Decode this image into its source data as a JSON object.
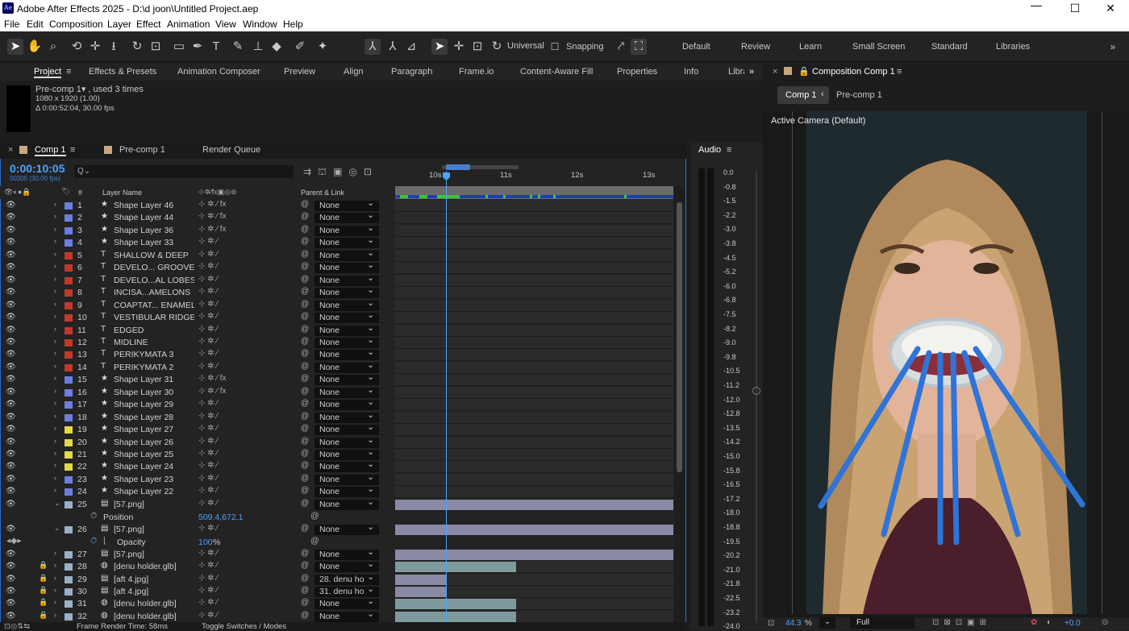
{
  "window": {
    "title": "Adobe After Effects 2025 - D:\\d joon\\Untitled Project.aep",
    "app_badge": "Ae"
  },
  "menu": [
    "File",
    "Edit",
    "Composition",
    "Layer",
    "Effect",
    "Animation",
    "View",
    "Window",
    "Help"
  ],
  "toolbar": {
    "universal_label": "Universal",
    "snapping_label": "Snapping"
  },
  "workspaces": [
    "Default",
    "Review",
    "Learn",
    "Small Screen",
    "Standard",
    "Libraries"
  ],
  "panel_tabs": [
    "Project",
    "Effects & Presets",
    "Animation Composer",
    "Preview",
    "Align",
    "Paragraph",
    "Frame.io",
    "Content-Aware Fill",
    "Properties",
    "Info",
    "Libra"
  ],
  "project_info": {
    "name": "Pre-comp 1▾ , used 3 times",
    "dims": "1080 x 1920 (1.00)",
    "duration": "Δ 0:00:52:04, 30.00 fps"
  },
  "timeline": {
    "tabs": [
      "Comp 1",
      "Pre-comp 1",
      "Render Queue"
    ],
    "timecode": "0:00:10:05",
    "timecode_sub": "00305 (30.00 fps)",
    "search_placeholder": "Q⌄",
    "col_layer_name": "Layer Name",
    "col_parent": "Parent & Link",
    "ruler": [
      "10s",
      "11s",
      "12s",
      "13s"
    ],
    "footer_left": "Frame Render Time: 58ms",
    "footer_mid": "Toggle Switches / Modes"
  },
  "layers": [
    {
      "n": "1",
      "icon": "★",
      "name": "Shape Layer 46",
      "color": "#6c7ee0",
      "fx": true,
      "parent": "None"
    },
    {
      "n": "2",
      "icon": "★",
      "name": "Shape Layer 44",
      "color": "#6c7ee0",
      "fx": true,
      "parent": "None"
    },
    {
      "n": "3",
      "icon": "★",
      "name": "Shape Layer 36",
      "color": "#6c7ee0",
      "fx": true,
      "parent": "None"
    },
    {
      "n": "4",
      "icon": "★",
      "name": "Shape Layer 33",
      "color": "#6c7ee0",
      "fx": false,
      "parent": "None"
    },
    {
      "n": "5",
      "icon": "T",
      "name": "SHALLOW & DEEP",
      "color": "#c0392b",
      "fx": false,
      "parent": "None"
    },
    {
      "n": "6",
      "icon": "T",
      "name": "DEVELO... GROOVES",
      "color": "#c0392b",
      "fx": false,
      "parent": "None"
    },
    {
      "n": "7",
      "icon": "T",
      "name": "DEVELO...AL LOBES",
      "color": "#c0392b",
      "fx": false,
      "parent": "None"
    },
    {
      "n": "8",
      "icon": "T",
      "name": "INCISA...AMELONS",
      "color": "#c0392b",
      "fx": false,
      "parent": "None"
    },
    {
      "n": "9",
      "icon": "T",
      "name": "COAPTAT... ENAMEL",
      "color": "#c0392b",
      "fx": false,
      "parent": "None"
    },
    {
      "n": "10",
      "icon": "T",
      "name": "VESTIBULAR RIDGE",
      "color": "#c0392b",
      "fx": false,
      "parent": "None"
    },
    {
      "n": "11",
      "icon": "T",
      "name": "EDGED",
      "color": "#c0392b",
      "fx": false,
      "parent": "None"
    },
    {
      "n": "12",
      "icon": "T",
      "name": "MIDLINE",
      "color": "#c0392b",
      "fx": false,
      "parent": "None"
    },
    {
      "n": "13",
      "icon": "T",
      "name": "PERIKYMATA 3",
      "color": "#c0392b",
      "fx": false,
      "parent": "None"
    },
    {
      "n": "14",
      "icon": "T",
      "name": "PERIKYMATA 2",
      "color": "#c0392b",
      "fx": false,
      "parent": "None"
    },
    {
      "n": "15",
      "icon": "★",
      "name": "Shape Layer 31",
      "color": "#6c7ee0",
      "fx": true,
      "parent": "None"
    },
    {
      "n": "16",
      "icon": "★",
      "name": "Shape Layer 30",
      "color": "#6c7ee0",
      "fx": true,
      "parent": "None"
    },
    {
      "n": "17",
      "icon": "★",
      "name": "Shape Layer 29",
      "color": "#6c7ee0",
      "fx": false,
      "parent": "None"
    },
    {
      "n": "18",
      "icon": "★",
      "name": "Shape Layer 28",
      "color": "#6c7ee0",
      "fx": false,
      "parent": "None"
    },
    {
      "n": "19",
      "icon": "★",
      "name": "Shape Layer 27",
      "color": "#e3d84a",
      "fx": false,
      "parent": "None"
    },
    {
      "n": "20",
      "icon": "★",
      "name": "Shape Layer 26",
      "color": "#e3d84a",
      "fx": false,
      "parent": "None"
    },
    {
      "n": "21",
      "icon": "★",
      "name": "Shape Layer 25",
      "color": "#e3d84a",
      "fx": false,
      "parent": "None"
    },
    {
      "n": "22",
      "icon": "★",
      "name": "Shape Layer 24",
      "color": "#e3d84a",
      "fx": false,
      "parent": "None"
    },
    {
      "n": "23",
      "icon": "★",
      "name": "Shape Layer 23",
      "color": "#6c7ee0",
      "fx": false,
      "parent": "None"
    },
    {
      "n": "24",
      "icon": "★",
      "name": "Shape Layer 22",
      "color": "#6c7ee0",
      "fx": false,
      "parent": "None"
    }
  ],
  "layer25": {
    "n": "25",
    "name": "[57.png]",
    "parent": "None",
    "prop": "Position",
    "value": "509.4,672.1"
  },
  "layer26": {
    "n": "26",
    "name": "[57.png]",
    "parent": "None",
    "prop": "Opacity",
    "value": "100",
    "unit": "%"
  },
  "lower_layers": [
    {
      "n": "27",
      "name": "[57.png]",
      "color": "#9ab0c8",
      "parent": "None"
    },
    {
      "n": "28",
      "name": "[denu holder.glb]",
      "color": "#9ab0c8",
      "parent": "None"
    },
    {
      "n": "29",
      "name": "[aft 4.jpg]",
      "color": "#9ab0c8",
      "parent": "28. denu ho"
    },
    {
      "n": "30",
      "name": "[aft 4.jpg]",
      "color": "#9ab0c8",
      "parent": "31. denu ho"
    },
    {
      "n": "31",
      "name": "[denu holder.glb]",
      "color": "#9ab0c8",
      "parent": "None"
    },
    {
      "n": "32",
      "name": "[denu holder.glb]",
      "color": "#9ab0c8",
      "parent": "None"
    }
  ],
  "audio": {
    "title": "Audio",
    "db": [
      "0.0",
      "-0.8",
      "-1.5",
      "-2.2",
      "-3.0",
      "-3.8",
      "-4.5",
      "-5.2",
      "-6.0",
      "-6.8",
      "-7.5",
      "-8.2",
      "-9.0",
      "-9.8",
      "-10.5",
      "-11.2",
      "-12.0",
      "-12.8",
      "-13.5",
      "-14.2",
      "-15.0",
      "-15.8",
      "-16.5",
      "-17.2",
      "-18.0",
      "-18.8",
      "-19.5",
      "-20.2",
      "-21.0",
      "-21.8",
      "-22.5",
      "-23.2",
      "-24.0"
    ]
  },
  "viewer": {
    "title": "Composition Comp 1",
    "crumb1": "Comp 1",
    "crumb2": "Pre-comp 1",
    "camera": "Active Camera (Default)",
    "zoom": "44.3",
    "zoom_unit": "%",
    "resolution": "Full",
    "exposure": "+0.0"
  }
}
